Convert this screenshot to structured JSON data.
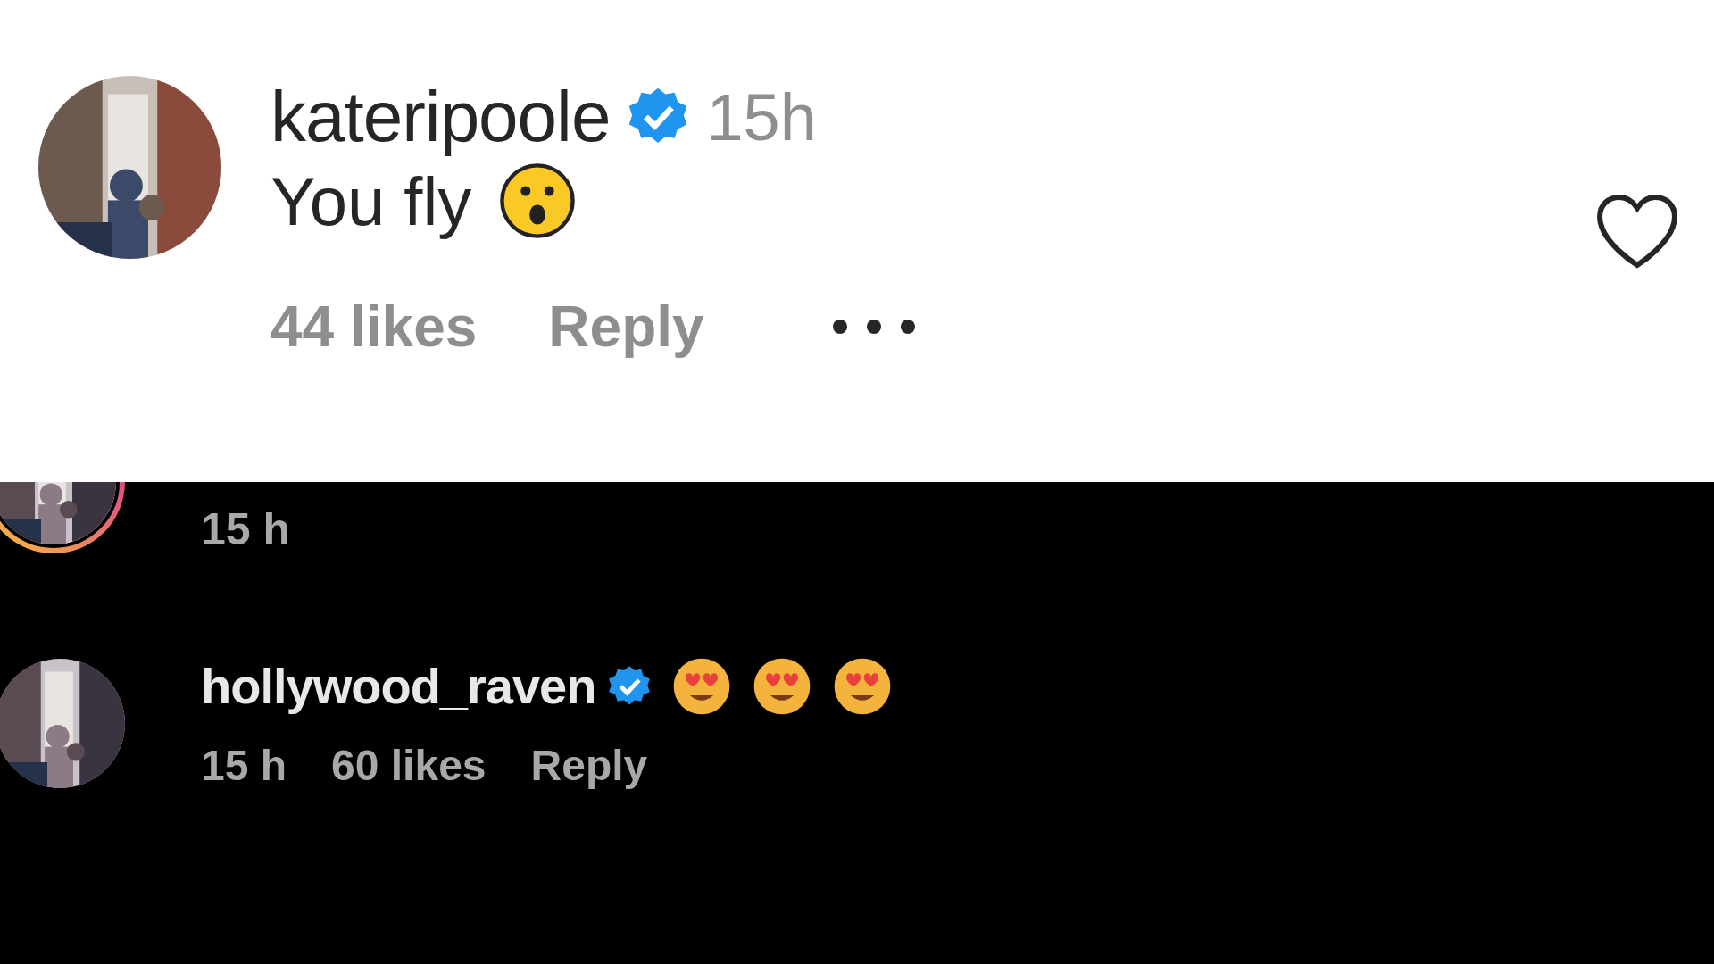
{
  "light_comment": {
    "username": "kateripoole",
    "verified": true,
    "time": "15h",
    "text": "You fly",
    "liked": false,
    "likes": "44 likes",
    "reply": "Reply"
  },
  "dark_thread": [
    {
      "kind": "partial",
      "time": "15 h"
    },
    {
      "kind": "comment",
      "username": "hollywood_raven",
      "verified": true,
      "time": "15 h",
      "likes": "60 likes",
      "reply": "Reply"
    }
  ]
}
